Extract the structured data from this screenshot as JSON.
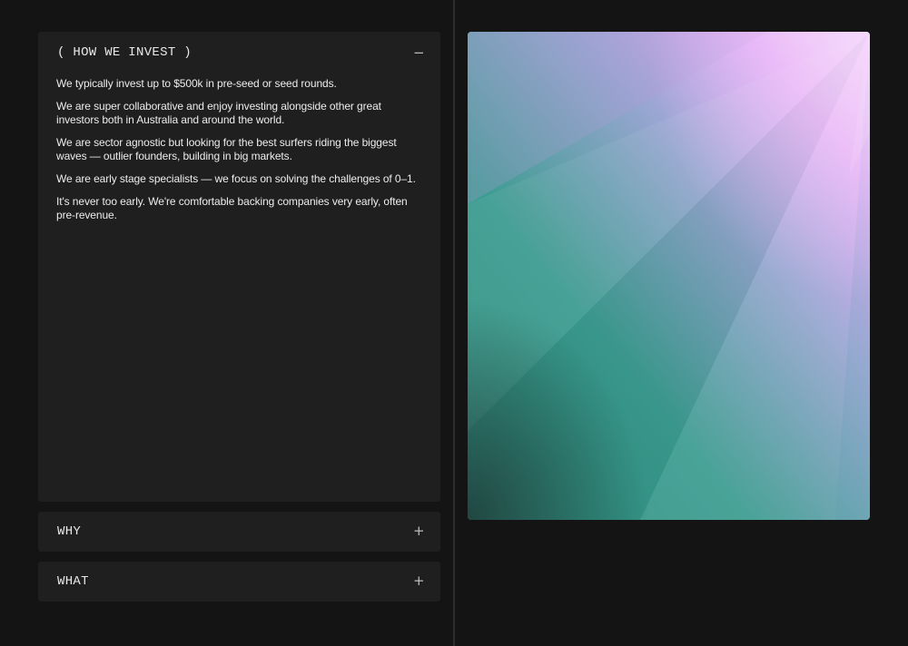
{
  "accordion": {
    "how_we_invest": {
      "title": "( HOW WE INVEST )",
      "toggle": "−",
      "paragraphs": [
        "We typically invest up to $500k in pre-seed or seed rounds.",
        "We are super collaborative and enjoy investing alongside other great investors both in Australia and around the world.",
        "We are sector agnostic but looking for the best surfers riding the biggest waves — outlier founders, building in big markets.",
        "We are early stage specialists  — we focus on solving the challenges of 0–1.",
        "It's never too early. We're comfortable backing companies very early, often pre-revenue."
      ]
    },
    "why": {
      "title": "WHY",
      "toggle": "+"
    },
    "what": {
      "title": "WHAT",
      "toggle": "+"
    }
  },
  "colors": {
    "background": "#141414",
    "panel": "#1f1f1f",
    "text": "#ededed",
    "gradient_teal": "#3a9a8a",
    "gradient_pink": "#e8a6f5"
  }
}
